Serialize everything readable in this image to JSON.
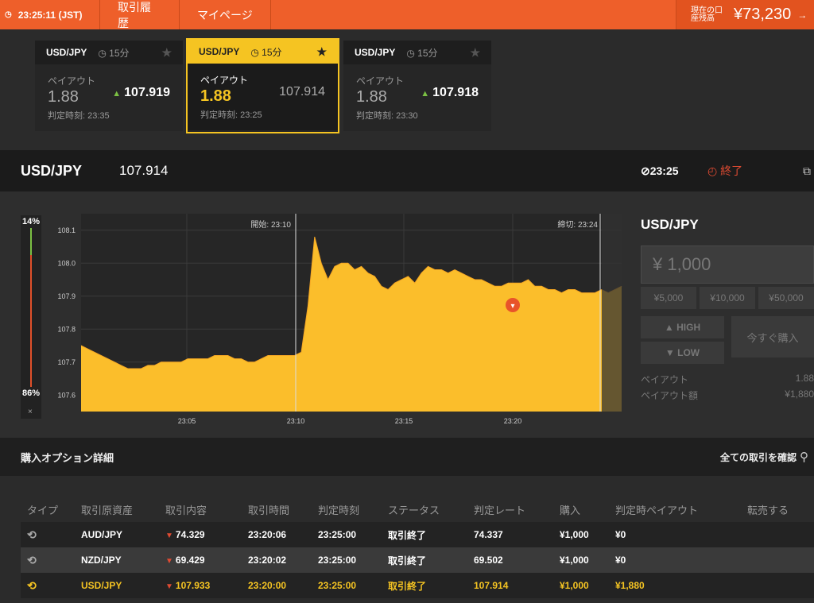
{
  "topbar": {
    "time": "23:25:11 (JST)",
    "nav": [
      "取引履歴",
      "マイページ"
    ],
    "balance_label": "現在の口座残高",
    "balance": "¥73,230"
  },
  "cards": [
    {
      "pair": "USD/JPY",
      "duration": "15分",
      "payout_label": "ペイアウト",
      "payout": "1.88",
      "rate": "107.919",
      "judge": "判定時刻: 23:35"
    },
    {
      "pair": "USD/JPY",
      "duration": "15分",
      "payout_label": "ペイアウト",
      "payout": "1.88",
      "rate": "107.914",
      "judge": "判定時刻: 23:25"
    },
    {
      "pair": "USD/JPY",
      "duration": "15分",
      "payout_label": "ペイアウト",
      "payout": "1.88",
      "rate": "107.918",
      "judge": "判定時刻: 23:30"
    }
  ],
  "pairbar": {
    "symbol": "USD/JPY",
    "price": "107.914",
    "expiry": "23:25",
    "status": "終了"
  },
  "ratio": {
    "high": "14%",
    "low": "86%",
    "close": "×"
  },
  "chart_data": {
    "type": "area",
    "start_label": "開始: 23:10",
    "deadline_label": "締切: 23:24",
    "yticks": [
      "108.1",
      "108.0",
      "107.9",
      "107.8",
      "107.7",
      "107.6"
    ],
    "xticks": [
      "23:05",
      "23:10",
      "23:15",
      "23:20"
    ],
    "ylim": [
      107.55,
      108.15
    ],
    "series": [
      {
        "values": [
          107.75,
          107.74,
          107.73,
          107.72,
          107.71,
          107.7,
          107.69,
          107.68,
          107.68,
          107.68,
          107.69,
          107.69,
          107.7,
          107.7,
          107.7,
          107.7,
          107.71,
          107.71,
          107.71,
          107.71,
          107.72,
          107.72,
          107.72,
          107.71,
          107.71,
          107.7,
          107.7,
          107.71,
          107.72,
          107.72,
          107.72,
          107.72,
          107.72,
          107.73,
          107.87,
          108.08,
          108.0,
          107.95,
          107.99,
          108.0,
          108.0,
          107.98,
          107.99,
          107.97,
          107.96,
          107.93,
          107.92,
          107.94,
          107.95,
          107.96,
          107.94,
          107.97,
          107.99,
          107.98,
          107.98,
          107.97,
          107.98,
          107.97,
          107.96,
          107.95,
          107.95,
          107.94,
          107.93,
          107.93,
          107.94,
          107.94,
          107.94,
          107.95,
          107.93,
          107.93,
          107.92,
          107.92,
          107.91,
          107.92,
          107.92,
          107.91,
          107.91,
          107.91,
          107.92,
          107.91,
          107.92,
          107.93
        ]
      }
    ]
  },
  "side": {
    "pair": "USD/JPY",
    "amount": "¥ 1,000",
    "quick": [
      "¥5,000",
      "¥10,000",
      "¥50,000"
    ],
    "high": "HIGH",
    "low": "LOW",
    "buy": "今すぐ購入",
    "payout_label": "ペイアウト",
    "payout": "1.88",
    "payout_amount_label": "ペイアウト額",
    "payout_amount": "¥1,880"
  },
  "section": {
    "title": "購入オプション詳細",
    "all": "全ての取引を確認"
  },
  "table": {
    "headers": [
      "タイプ",
      "取引原資産",
      "取引内容",
      "取引時間",
      "判定時刻",
      "ステータス",
      "判定レート",
      "購入",
      "判定時ペイアウト",
      "転売する"
    ],
    "rows": [
      [
        "AUD/JPY",
        "74.329",
        "23:20:06",
        "23:25:00",
        "取引終了",
        "74.337",
        "¥1,000",
        "¥0"
      ],
      [
        "NZD/JPY",
        "69.429",
        "23:20:02",
        "23:25:00",
        "取引終了",
        "69.502",
        "¥1,000",
        "¥0"
      ],
      [
        "USD/JPY",
        "107.933",
        "23:20:00",
        "23:25:00",
        "取引終了",
        "107.914",
        "¥1,000",
        "¥1,880"
      ]
    ]
  }
}
